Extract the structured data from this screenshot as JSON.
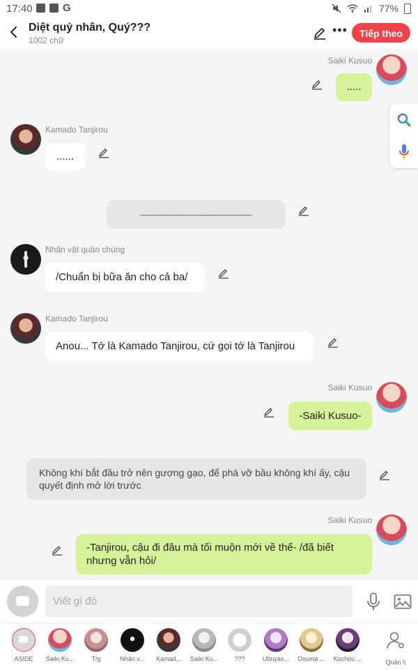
{
  "status_bar": {
    "time": "17:40",
    "battery": "77%"
  },
  "header": {
    "title": "Diệt quỷ nhân, Quý???",
    "word_count": "1002 chữ",
    "next_label": "Tiếp theo",
    "accent_color": "#f0444a"
  },
  "chat": {
    "messages": [
      {
        "speaker": "Saiki Kusuo",
        "side": "right",
        "text": ".....",
        "style": "green"
      },
      {
        "speaker": "Kamado Tanjirou",
        "side": "left",
        "text": "......",
        "style": "white"
      },
      {
        "speaker": "",
        "side": "center",
        "text": "_______________________________",
        "style": "gray"
      },
      {
        "speaker": "Nhân vật quần chúng",
        "side": "left",
        "text": "/Chuẩn bị bữa ăn cho cả ba/",
        "style": "white"
      },
      {
        "speaker": "Kamado Tanjirou",
        "side": "left",
        "text": "Anou... Tớ là Kamado Tanjirou, cứ gọi tớ là Tanjirou",
        "style": "white"
      },
      {
        "speaker": "Saiki Kusuo",
        "side": "right",
        "text": "-Saiki Kusuo-",
        "style": "green"
      },
      {
        "speaker": "",
        "side": "center",
        "text": "Không khí bắt đầu trở nên gượng gạo, để phá vỡ bầu không khí ấy, cậu quyết định mở lời trước",
        "style": "gray"
      },
      {
        "speaker": "Saiki Kusuo",
        "side": "right",
        "text": "-Tanjirou, cậu đi đâu mà tối muộn mới về thế- /đã biết nhưng vẫn hỏi/",
        "style": "green"
      }
    ]
  },
  "input": {
    "placeholder": "Viết gì đó"
  },
  "characters": [
    {
      "label": "ASIDE"
    },
    {
      "label": "Saiki Ku..."
    },
    {
      "label": "T/g"
    },
    {
      "label": "Nhân v..."
    },
    {
      "label": "Kamad..."
    },
    {
      "label": "Saiki Ku..."
    },
    {
      "label": "???"
    },
    {
      "label": "Ubuyas..."
    },
    {
      "label": "Douma ..."
    },
    {
      "label": "Kochou ..."
    },
    {
      "label": "Quản lí"
    }
  ]
}
